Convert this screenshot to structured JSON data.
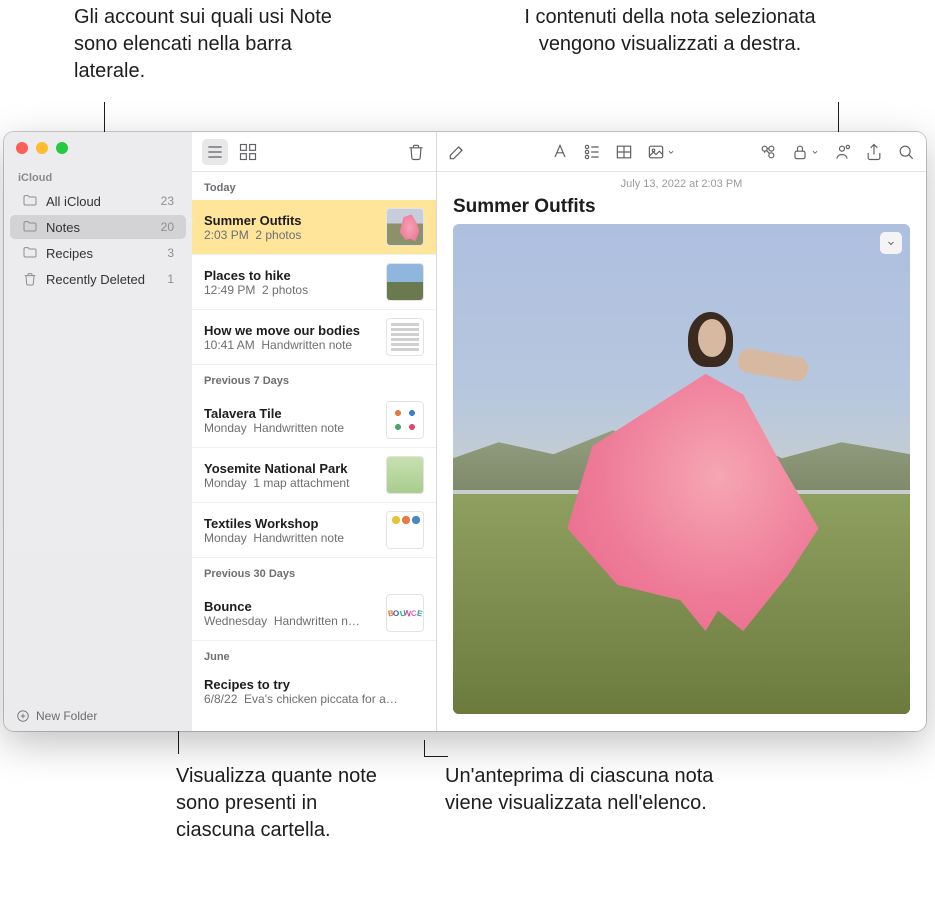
{
  "callouts": {
    "top_left": "Gli account sui quali usi Note sono elencati nella barra laterale.",
    "top_right": "I contenuti della nota selezionata vengono visualizzati a destra.",
    "bottom_left": "Visualizza quante note sono presenti in ciascuna cartella.",
    "bottom_right": "Un'anteprima di ciascuna nota viene visualizzata nell'elenco."
  },
  "sidebar": {
    "account": "iCloud",
    "folders": [
      {
        "name": "All iCloud",
        "count": "23",
        "icon": "folder"
      },
      {
        "name": "Notes",
        "count": "20",
        "icon": "folder",
        "selected": true
      },
      {
        "name": "Recipes",
        "count": "3",
        "icon": "folder"
      },
      {
        "name": "Recently Deleted",
        "count": "1",
        "icon": "trash"
      }
    ],
    "new_folder": "New Folder"
  },
  "notes_list": {
    "sections": [
      {
        "header": "Today",
        "items": [
          {
            "title": "Summer Outfits",
            "time": "2:03 PM",
            "detail": "2 photos",
            "thumb": "thumb-pink",
            "selected": true
          },
          {
            "title": "Places to hike",
            "time": "12:49 PM",
            "detail": "2 photos",
            "thumb": "thumb-hike"
          },
          {
            "title": "How we move our bodies",
            "time": "10:41 AM",
            "detail": "Handwritten note",
            "thumb": "thumb-doc"
          }
        ]
      },
      {
        "header": "Previous 7 Days",
        "items": [
          {
            "title": "Talavera Tile",
            "time": "Monday",
            "detail": "Handwritten note",
            "thumb": "thumb-tile"
          },
          {
            "title": "Yosemite National Park",
            "time": "Monday",
            "detail": "1 map attachment",
            "thumb": "thumb-map"
          },
          {
            "title": "Textiles Workshop",
            "time": "Monday",
            "detail": "Handwritten note",
            "thumb": "thumb-wk"
          }
        ]
      },
      {
        "header": "Previous 30 Days",
        "items": [
          {
            "title": "Bounce",
            "time": "Wednesday",
            "detail": "Handwritten n…",
            "thumb": "thumb-bounce"
          }
        ]
      },
      {
        "header": "June",
        "items": [
          {
            "title": "Recipes to try",
            "time": "6/8/22",
            "detail": "Eva's chicken piccata for a…",
            "thumb": ""
          }
        ]
      }
    ]
  },
  "note": {
    "timestamp": "July 13, 2022 at 2:03 PM",
    "title": "Summer Outfits"
  }
}
